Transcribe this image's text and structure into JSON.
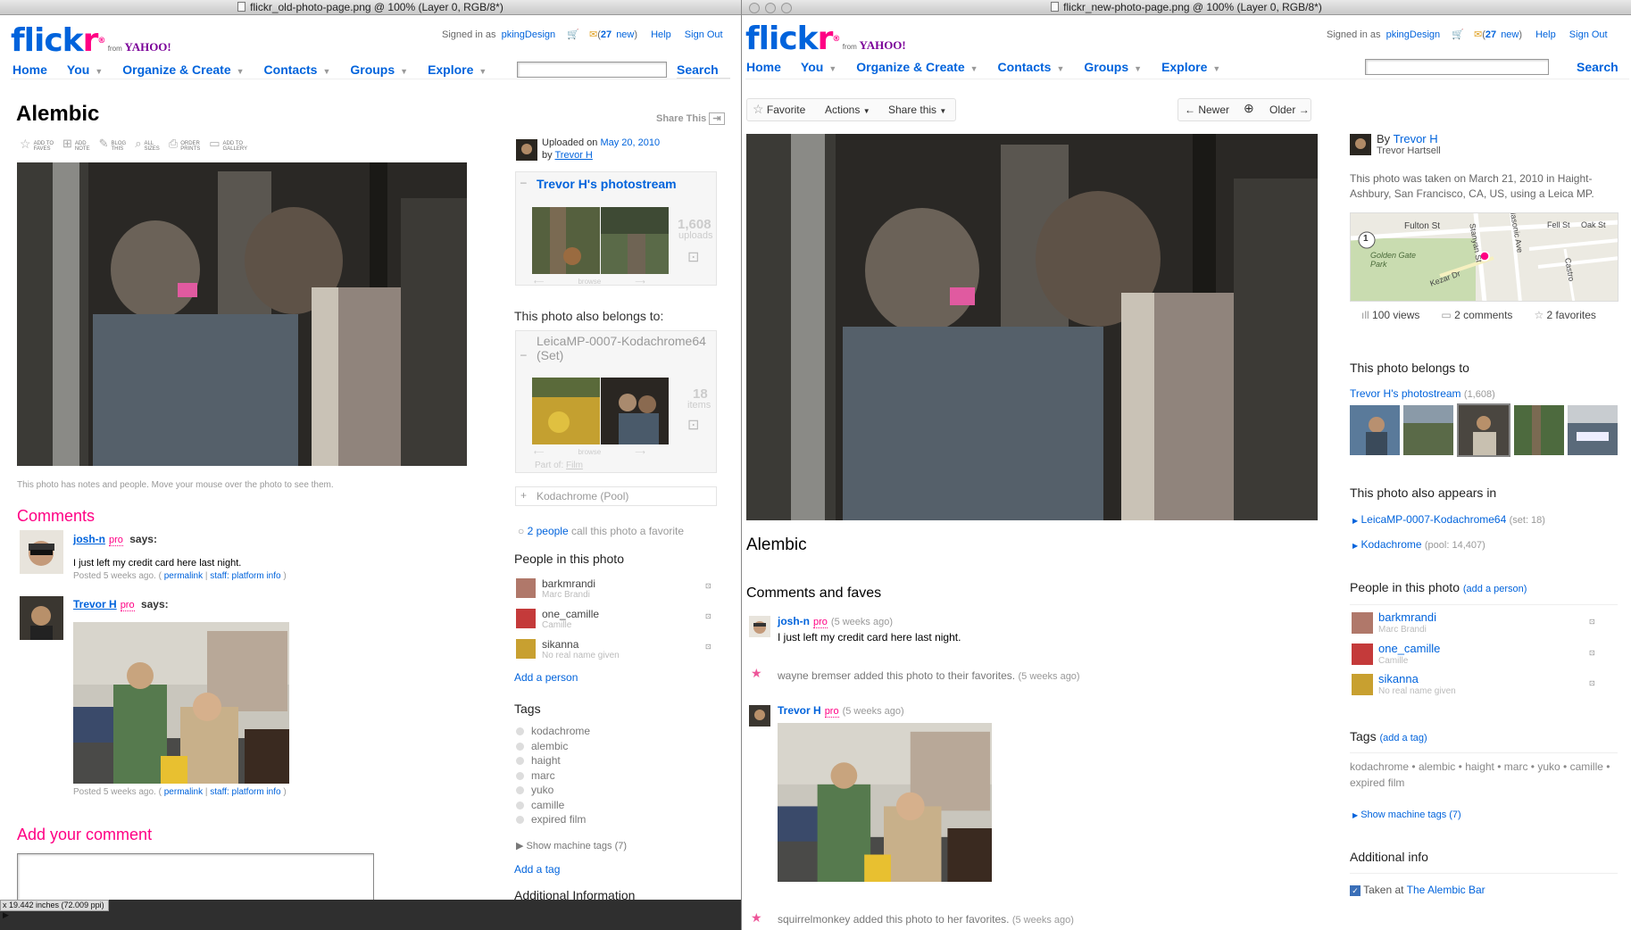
{
  "old_window": {
    "title": "flickr_old-photo-page.png @ 100% (Layer 0, RGB/8*)",
    "signed_in_label": "Signed in as",
    "username": "pkingDesign",
    "new_count": "27",
    "new_label": "new",
    "help": "Help",
    "sign_out": "Sign Out",
    "nav": [
      "Home",
      "You",
      "Organize & Create",
      "Contacts",
      "Groups",
      "Explore"
    ],
    "search_label": "Search",
    "photo_title": "Alembic",
    "share_this": "Share This",
    "toolbar": [
      {
        "l1": "ADD TO",
        "l2": "FAVES"
      },
      {
        "l1": "ADD",
        "l2": "NOTE"
      },
      {
        "l1": "BLOG",
        "l2": "THIS"
      },
      {
        "l1": "ALL",
        "l2": "SIZES"
      },
      {
        "l1": "ORDER",
        "l2": "PRINTS"
      },
      {
        "l1": "ADD TO",
        "l2": "GALLERY"
      }
    ],
    "notes_caption": "This photo has notes and people. Move your mouse over the photo to see them.",
    "comments_heading": "Comments",
    "comments": [
      {
        "user": "josh-n",
        "pro": "pro",
        "says": "says:",
        "text": "I just left my credit card here last night.",
        "posted": "Posted 5 weeks ago. (",
        "permalink": "permalink",
        "sep": "|",
        "staff": "staff: platform info",
        "close": ")"
      },
      {
        "user": "Trevor H",
        "pro": "pro",
        "says": "says:",
        "posted": "Posted 5 weeks ago. (",
        "permalink": "permalink",
        "sep": "|",
        "staff": "staff: platform info",
        "close": ")"
      }
    ],
    "add_comment_heading": "Add your comment",
    "uploaded_on": "Uploaded on",
    "upload_date": "May 20, 2010",
    "by": "by",
    "owner": "Trevor H",
    "photostream_title": "Trevor H's photostream",
    "photostream_count": "1,608",
    "photostream_count_label": "uploads",
    "browse": "browse",
    "belongs_heading": "This photo also belongs to:",
    "set_title": "LeicaMP-0007-Kodachrome64 (Set)",
    "set_count": "18",
    "set_count_label": "items",
    "part_of": "Part of:",
    "part_of_link": "Film",
    "pool_title": "Kodachrome (Pool)",
    "fav_count_link": "2 people",
    "fav_text": "call this photo a favorite",
    "people_heading": "People in this photo",
    "people": [
      {
        "user": "barkmrandi",
        "real": "Marc Brandi"
      },
      {
        "user": "one_camille",
        "real": "Camille"
      },
      {
        "user": "sikanna",
        "real": "No real name given"
      }
    ],
    "add_person": "Add a person",
    "tags_heading": "Tags",
    "tags": [
      "kodachrome",
      "alembic",
      "haight",
      "marc",
      "yuko",
      "camille",
      "expired film"
    ],
    "machine_tags": "Show machine tags (7)",
    "add_tag": "Add a tag",
    "additional_info": "Additional Information",
    "status": "x 19.442 inches (72.009 ppi)"
  },
  "new_window": {
    "title": "flickr_new-photo-page.png @ 100% (Layer 0, RGB/8*)",
    "signed_in_label": "Signed in as",
    "username": "pkingDesign",
    "new_count": "27",
    "new_label": "new",
    "help": "Help",
    "sign_out": "Sign Out",
    "nav": [
      "Home",
      "You",
      "Organize & Create",
      "Contacts",
      "Groups",
      "Explore"
    ],
    "search_label": "Search",
    "favorite": "Favorite",
    "actions": "Actions",
    "share_this": "Share this",
    "newer": "Newer",
    "older": "Older",
    "by": "By",
    "owner": "Trevor H",
    "owner_real": "Trevor Hartsell",
    "taken_text": "This photo was taken on March 21, 2010 in Haight-Ashbury, San Francisco, CA, US, using a Leica MP.",
    "map_labels": [
      "Fulton St",
      "Golden Gate Park",
      "Kezar Dr",
      "Stanyan St",
      "Masonic Ave",
      "Fell St",
      "Oak St",
      "Castro"
    ],
    "map_route": "1",
    "views": "100 views",
    "comments_count": "2 comments",
    "favorites_count": "2 favorites",
    "belongs_heading": "This photo belongs to",
    "photostream_link": "Trevor H's photostream",
    "photostream_count": "(1,608)",
    "appears_heading": "This photo also appears in",
    "appears": [
      {
        "name": "LeicaMP-0007-Kodachrome64",
        "meta": "(set: 18)"
      },
      {
        "name": "Kodachrome",
        "meta": "(pool: 14,407)"
      }
    ],
    "people_heading": "People in this photo",
    "add_person": "(add a person)",
    "people": [
      {
        "user": "barkmrandi",
        "real": "Marc Brandi"
      },
      {
        "user": "one_camille",
        "real": "Camille"
      },
      {
        "user": "sikanna",
        "real": "No real name given"
      }
    ],
    "tags_heading": "Tags",
    "add_tag": "(add a tag)",
    "tags": [
      "kodachrome",
      "alembic",
      "haight",
      "marc",
      "yuko",
      "camille",
      "expired film"
    ],
    "machine_tags": "Show machine tags (7)",
    "additional_info": "Additional info",
    "taken_at": "Taken at",
    "venue": "The Alembic Bar",
    "photo_title": "Alembic",
    "comments_heading": "Comments and faves",
    "c1_user": "josh-n",
    "c1_pro": "pro",
    "c1_time": "(5 weeks ago)",
    "c1_text": "I just left my credit card here last night.",
    "fav1_text": "wayne bremser added this photo to their favorites.",
    "fav1_time": "(5 weeks ago)",
    "c2_user": "Trevor H",
    "c2_pro": "pro",
    "c2_time": "(5 weeks ago)",
    "fav2_text": "squirrelmonkey added this photo to her favorites.",
    "fav2_time": "(5 weeks ago)"
  },
  "colors": {
    "flickr_blue": "#0063dc",
    "flickr_pink": "#ff0084"
  }
}
